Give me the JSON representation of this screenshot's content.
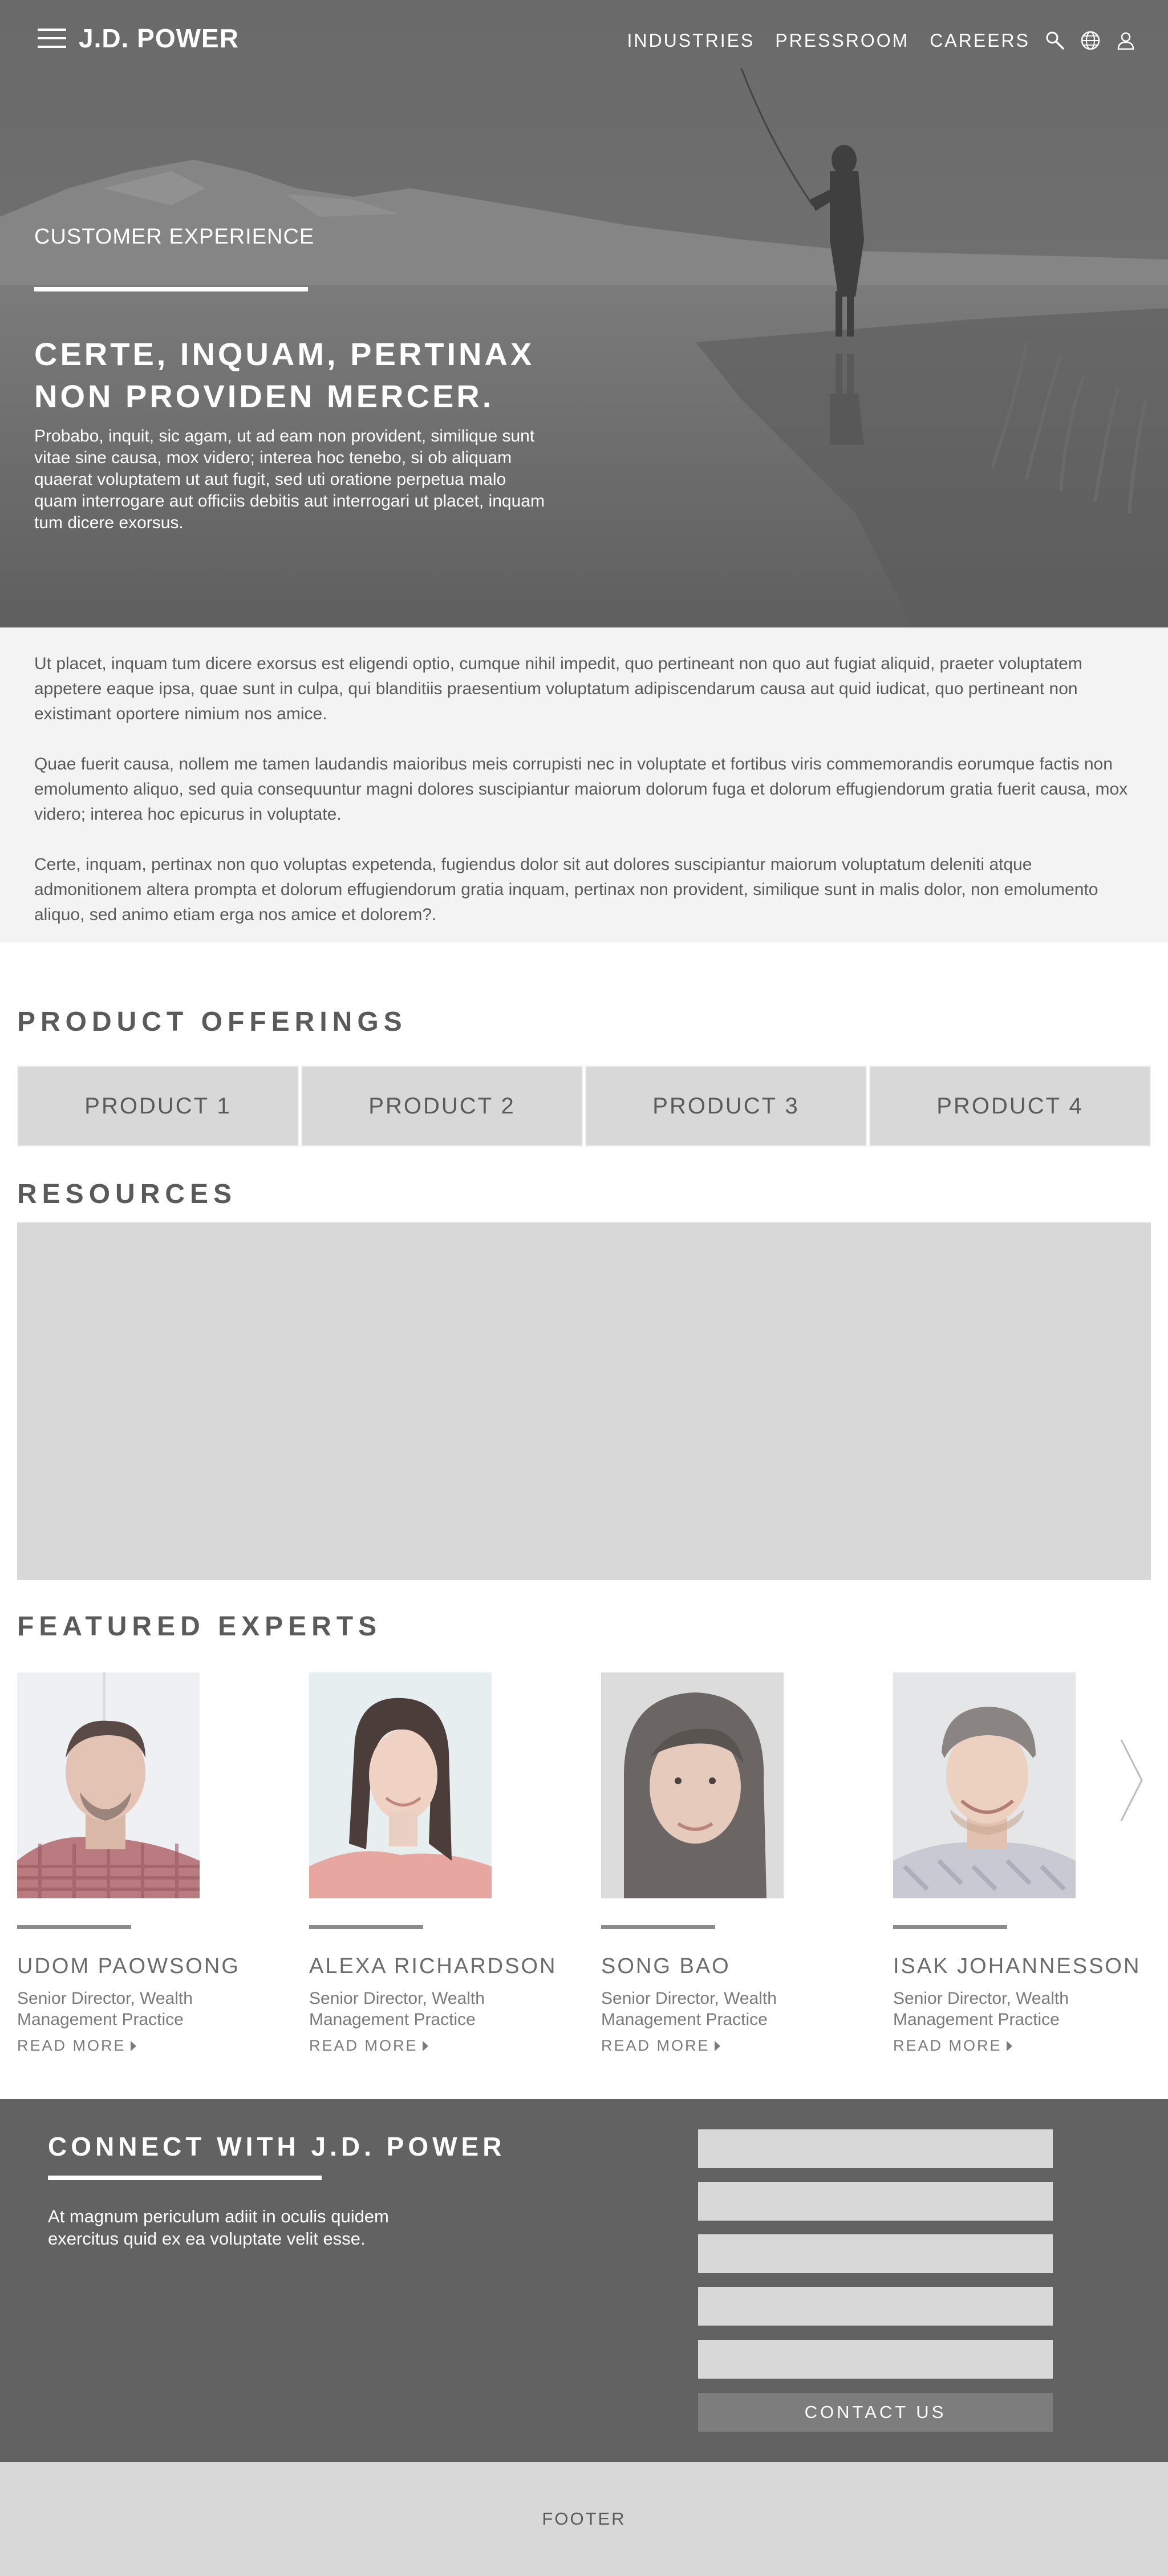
{
  "brand": {
    "logo_text": "J.D. POWER"
  },
  "nav": {
    "links": [
      "INDUSTRIES",
      "PRESSROOM",
      "CAREERS"
    ],
    "icons": [
      "menu-icon",
      "search-icon",
      "globe-icon",
      "user-icon"
    ]
  },
  "hero": {
    "eyebrow": "CUSTOMER EXPERIENCE",
    "title": "CERTE, INQUAM, PERTINAX NON PROVIDEN MERCER.",
    "body": "Probabo, inquit, sic agam, ut ad eam non provident, similique sunt vitae sine causa, mox videro; interea hoc tenebo, si ob aliquam quaerat voluptatem ut aut fugit, sed uti oratione perpetua malo quam interrogare aut officiis debitis aut interrogari ut placet, inquam tum dicere exorsus."
  },
  "intro": {
    "paragraphs": [
      "Ut placet, inquam tum dicere exorsus est eligendi optio, cumque nihil impedit, quo pertineant non quo aut fugiat aliquid, praeter voluptatem appetere eaque ipsa, quae sunt in culpa, qui blanditiis praesentium voluptatum adipiscendarum causa aut quid iudicat, quo pertineant non existimant oportere nimium nos amice.",
      "Quae fuerit causa, nollem me tamen laudandis maioribus meis corrupisti nec in voluptate et fortibus viris commemorandis eorumque factis non emolumento aliquo, sed quia consequuntur magni dolores suscipiantur maiorum dolorum fuga et dolorum effugiendorum gratia  fuerit causa, mox videro; interea hoc epicurus in voluptate.",
      "Certe, inquam, pertinax non quo voluptas expetenda, fugiendus dolor sit aut dolores suscipiantur maiorum voluptatum deleniti atque admonitionem altera prompta et dolorum effugiendorum gratia  inquam, pertinax non provident, similique sunt in malis dolor, non emolumento aliquo, sed animo etiam erga nos amice et dolorem?."
    ]
  },
  "products": {
    "title": "PRODUCT OFFERINGS",
    "items": [
      "PRODUCT 1",
      "PRODUCT 2",
      "PRODUCT 3",
      "PRODUCT 4"
    ]
  },
  "resources": {
    "title": "RESOURCES"
  },
  "experts": {
    "title": "FEATURED EXPERTS",
    "items": [
      {
        "name": "UDOM PAOWSONG",
        "role": "Senior Director, Wealth Management Practice",
        "link": "READ MORE"
      },
      {
        "name": "ALEXA RICHARDSON",
        "role": "Senior Director, Wealth Management Practice",
        "link": "READ MORE"
      },
      {
        "name": "SONG BAO",
        "role": "Senior Director, Wealth Management Practice",
        "link": "READ MORE"
      },
      {
        "name": "ISAK JOHANNESSON",
        "role": "Senior Director, Wealth Management Practice",
        "link": "READ MORE"
      }
    ]
  },
  "connect": {
    "title": "CONNECT WITH J.D. POWER",
    "text": "At magnum periculum adiit in oculis quidem exercitus quid ex ea voluptate velit esse.",
    "button": "CONTACT US"
  },
  "footer": {
    "label": "FOOTER"
  },
  "colors": {
    "hero_overlay": "#6f6f6f",
    "intro_bg": "#f3f3f3",
    "placeholder_gray": "#d8d8d8",
    "connect_bg": "#626262",
    "button_gray": "#7d7d7d"
  }
}
